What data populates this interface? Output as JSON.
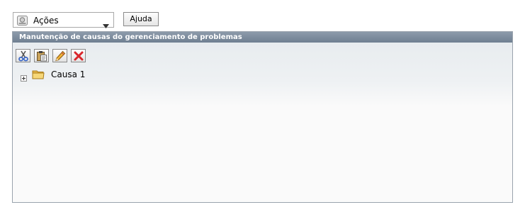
{
  "actions_menu": {
    "label": "Ações",
    "icon": "actions-icon"
  },
  "help_button": {
    "label": "Ajuda"
  },
  "panel": {
    "title": "Manutenção de causas do gerenciamento de problemas",
    "toolbar": [
      {
        "name": "cut-button",
        "icon": "scissors-icon"
      },
      {
        "name": "paste-button",
        "icon": "clipboard-icon"
      },
      {
        "name": "edit-button",
        "icon": "pencil-icon"
      },
      {
        "name": "delete-button",
        "icon": "red-x-icon"
      }
    ],
    "tree": [
      {
        "label": "Causa 1",
        "expanded": false
      }
    ]
  },
  "colors": {
    "header_bg": "#7b8a9b",
    "panel_border": "#9aa3ad",
    "folder": "#f2c94c",
    "delete_red": "#d9262b"
  }
}
